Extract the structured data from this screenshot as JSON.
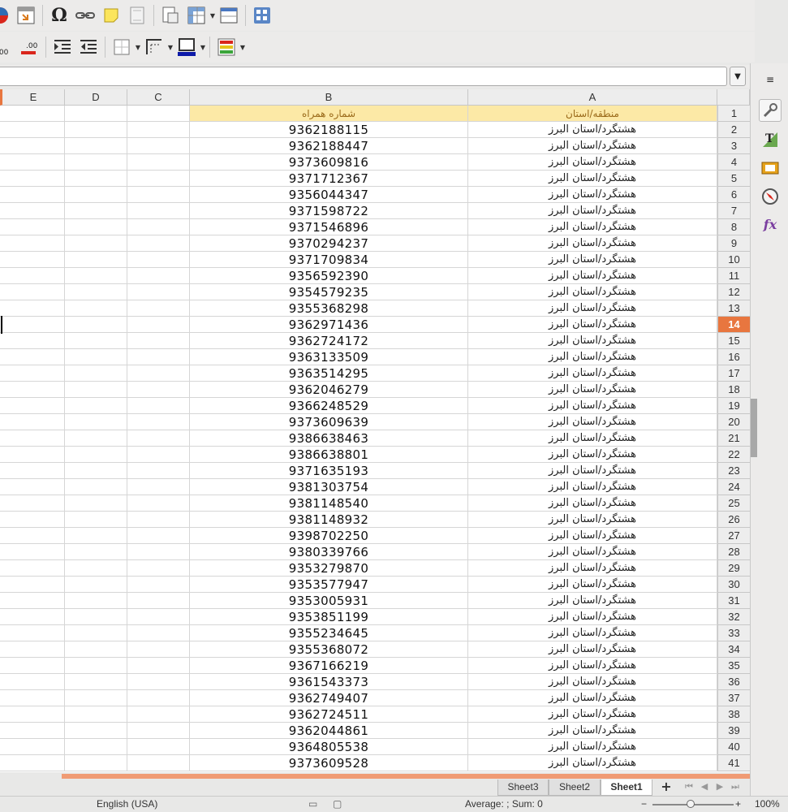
{
  "columns": [
    "E",
    "D",
    "C",
    "B",
    "A"
  ],
  "header_row": {
    "a": "منطقه/استان",
    "b": "شماره همراه"
  },
  "rows": [
    {
      "n": "2",
      "a": "هشتگرد/استان البرز",
      "b": "9362188115"
    },
    {
      "n": "3",
      "a": "هشتگرد/استان البرز",
      "b": "9362188447"
    },
    {
      "n": "4",
      "a": "هشتگرد/استان البرز",
      "b": "9373609816"
    },
    {
      "n": "5",
      "a": "هشتگرد/استان البرز",
      "b": "9371712367"
    },
    {
      "n": "6",
      "a": "هشتگرد/استان البرز",
      "b": "9356044347"
    },
    {
      "n": "7",
      "a": "هشتگرد/استان البرز",
      "b": "9371598722"
    },
    {
      "n": "8",
      "a": "هشتگرد/استان البرز",
      "b": "9371546896"
    },
    {
      "n": "9",
      "a": "هشتگرد/استان البرز",
      "b": "9370294237"
    },
    {
      "n": "10",
      "a": "هشتگرد/استان البرز",
      "b": "9371709834"
    },
    {
      "n": "11",
      "a": "هشتگرد/استان البرز",
      "b": "9356592390"
    },
    {
      "n": "12",
      "a": "هشتگرد/استان البرز",
      "b": "9354579235"
    },
    {
      "n": "13",
      "a": "هشتگرد/استان البرز",
      "b": "9355368298"
    },
    {
      "n": "14",
      "a": "هشتگرد/استان البرز",
      "b": "9362971436"
    },
    {
      "n": "15",
      "a": "هشتگرد/استان البرز",
      "b": "9362724172"
    },
    {
      "n": "16",
      "a": "هشتگرد/استان البرز",
      "b": "9363133509"
    },
    {
      "n": "17",
      "a": "هشتگرد/استان البرز",
      "b": "9363514295"
    },
    {
      "n": "18",
      "a": "هشتگرد/استان البرز",
      "b": "9362046279"
    },
    {
      "n": "19",
      "a": "هشتگرد/استان البرز",
      "b": "9366248529"
    },
    {
      "n": "20",
      "a": "هشتگرد/استان البرز",
      "b": "9373609639"
    },
    {
      "n": "21",
      "a": "هشتگرد/استان البرز",
      "b": "9386638463"
    },
    {
      "n": "22",
      "a": "هشتگرد/استان البرز",
      "b": "9386638801"
    },
    {
      "n": "23",
      "a": "هشتگرد/استان البرز",
      "b": "9371635193"
    },
    {
      "n": "24",
      "a": "هشتگرد/استان البرز",
      "b": "9381303754"
    },
    {
      "n": "25",
      "a": "هشتگرد/استان البرز",
      "b": "9381148540"
    },
    {
      "n": "26",
      "a": "هشتگرد/استان البرز",
      "b": "9381148932"
    },
    {
      "n": "27",
      "a": "هشتگرد/استان البرز",
      "b": "9398702250"
    },
    {
      "n": "28",
      "a": "هشتگرد/استان البرز",
      "b": "9380339766"
    },
    {
      "n": "29",
      "a": "هشتگرد/استان البرز",
      "b": "9353279870"
    },
    {
      "n": "30",
      "a": "هشتگرد/استان البرز",
      "b": "9353577947"
    },
    {
      "n": "31",
      "a": "هشتگرد/استان البرز",
      "b": "9353005931"
    },
    {
      "n": "32",
      "a": "هشتگرد/استان البرز",
      "b": "9353851199"
    },
    {
      "n": "33",
      "a": "هشتگرد/استان البرز",
      "b": "9355234645"
    },
    {
      "n": "34",
      "a": "هشتگرد/استان البرز",
      "b": "9355368072"
    },
    {
      "n": "35",
      "a": "هشتگرد/استان البرز",
      "b": "9367166219"
    },
    {
      "n": "36",
      "a": "هشتگرد/استان البرز",
      "b": "9361543373"
    },
    {
      "n": "37",
      "a": "هشتگرد/استان البرز",
      "b": "9362749407"
    },
    {
      "n": "38",
      "a": "هشتگرد/استان البرز",
      "b": "9362724511"
    },
    {
      "n": "39",
      "a": "هشتگرد/استان البرز",
      "b": "9362044861"
    },
    {
      "n": "40",
      "a": "هشتگرد/استان البرز",
      "b": "9364805538"
    },
    {
      "n": "41",
      "a": "هشتگرد/استان البرز",
      "b": "9373609528"
    }
  ],
  "header_row_number": "1",
  "selected_row": "14",
  "sheet_tabs": [
    "Sheet3",
    "Sheet2",
    "Sheet1"
  ],
  "active_sheet": "Sheet1",
  "status": {
    "language": "English (USA)",
    "summary": "Average: ; Sum: 0",
    "zoom": "100%"
  },
  "colors": {
    "accent": "#e8763f",
    "header_fill": "#fce9a6"
  }
}
